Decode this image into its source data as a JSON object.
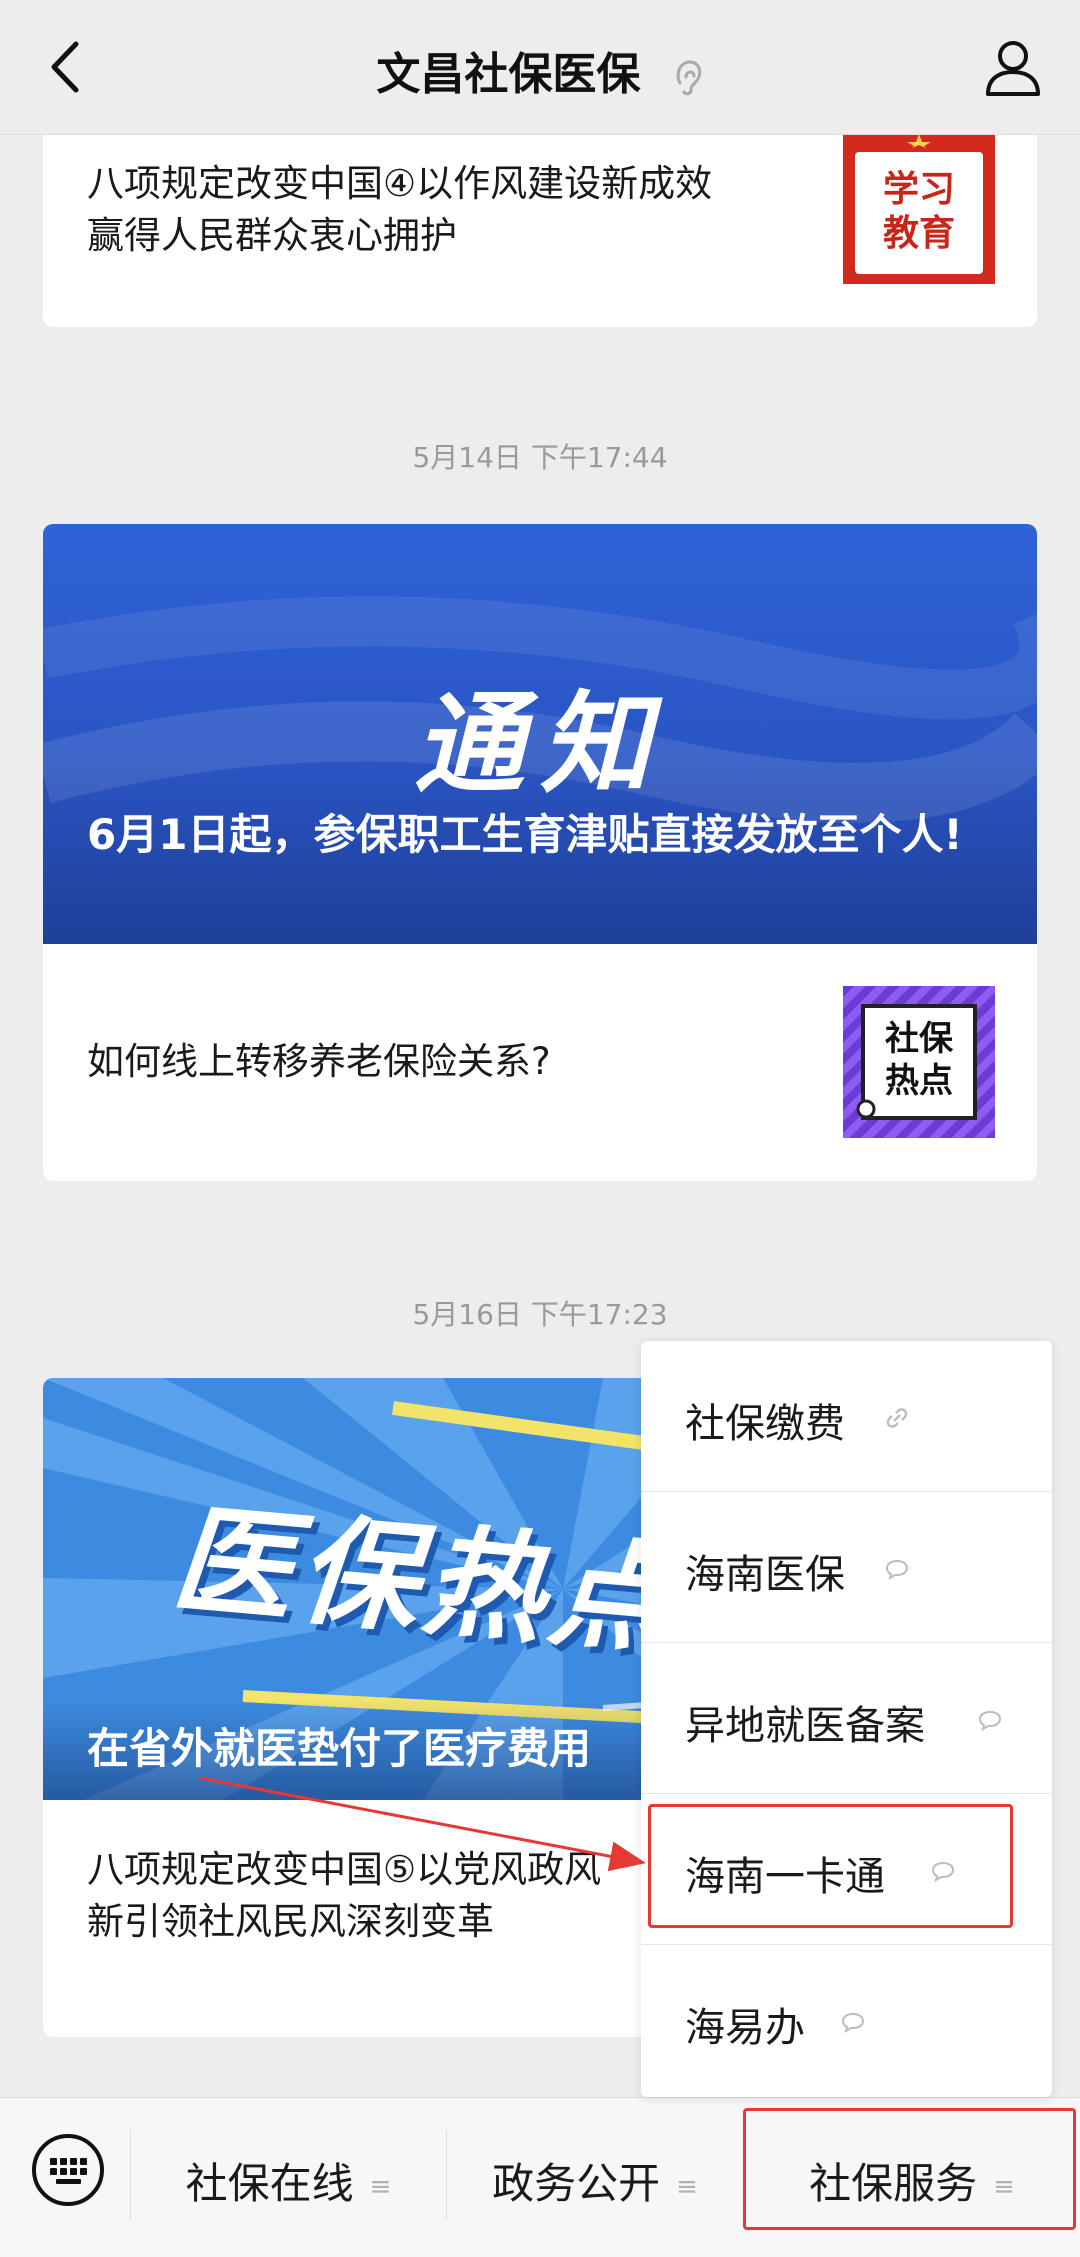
{
  "header": {
    "title": "文昌社保医保"
  },
  "feed": {
    "item1": {
      "text_line1": "八项规定改变中国④以作风建设新成效",
      "text_line2": "赢得人民群众衷心拥护",
      "thumb_line1": "学习",
      "thumb_line2": "教育"
    },
    "timestamp1": "5月14日 下午17:44",
    "item2": {
      "banner_title": "通知",
      "banner_caption": "6月1日起，参保职工生育津贴直接发放至个人!",
      "row_text": "如何线上转移养老保险关系?",
      "thumb_line1": "社保",
      "thumb_line2": "热点"
    },
    "timestamp2": "5月16日 下午17:23",
    "item3": {
      "banner_title": "医保热点",
      "banner_caption": "在省外就医垫付了医疗费用",
      "text_line1": "八项规定改变中国⑤以党风政风",
      "text_line2": "新引领社风民风深刻变革"
    }
  },
  "popup_menu": {
    "items": [
      {
        "label": "社保缴费",
        "icon": "link-icon"
      },
      {
        "label": "海南医保",
        "icon": "chat-bubble-icon"
      },
      {
        "label": "异地就医备案",
        "icon": "chat-bubble-icon"
      },
      {
        "label": "海南一卡通",
        "icon": "chat-bubble-icon"
      },
      {
        "label": "海易办",
        "icon": "chat-bubble-icon"
      }
    ]
  },
  "bottom_menu": {
    "tabs": [
      {
        "label": "社保在线"
      },
      {
        "label": "政务公开"
      },
      {
        "label": "社保服务"
      }
    ],
    "menu_marker": "≡"
  },
  "colors": {
    "highlight": "#e53935",
    "banner_blue": "#2f5fd0",
    "background": "#ededed"
  }
}
